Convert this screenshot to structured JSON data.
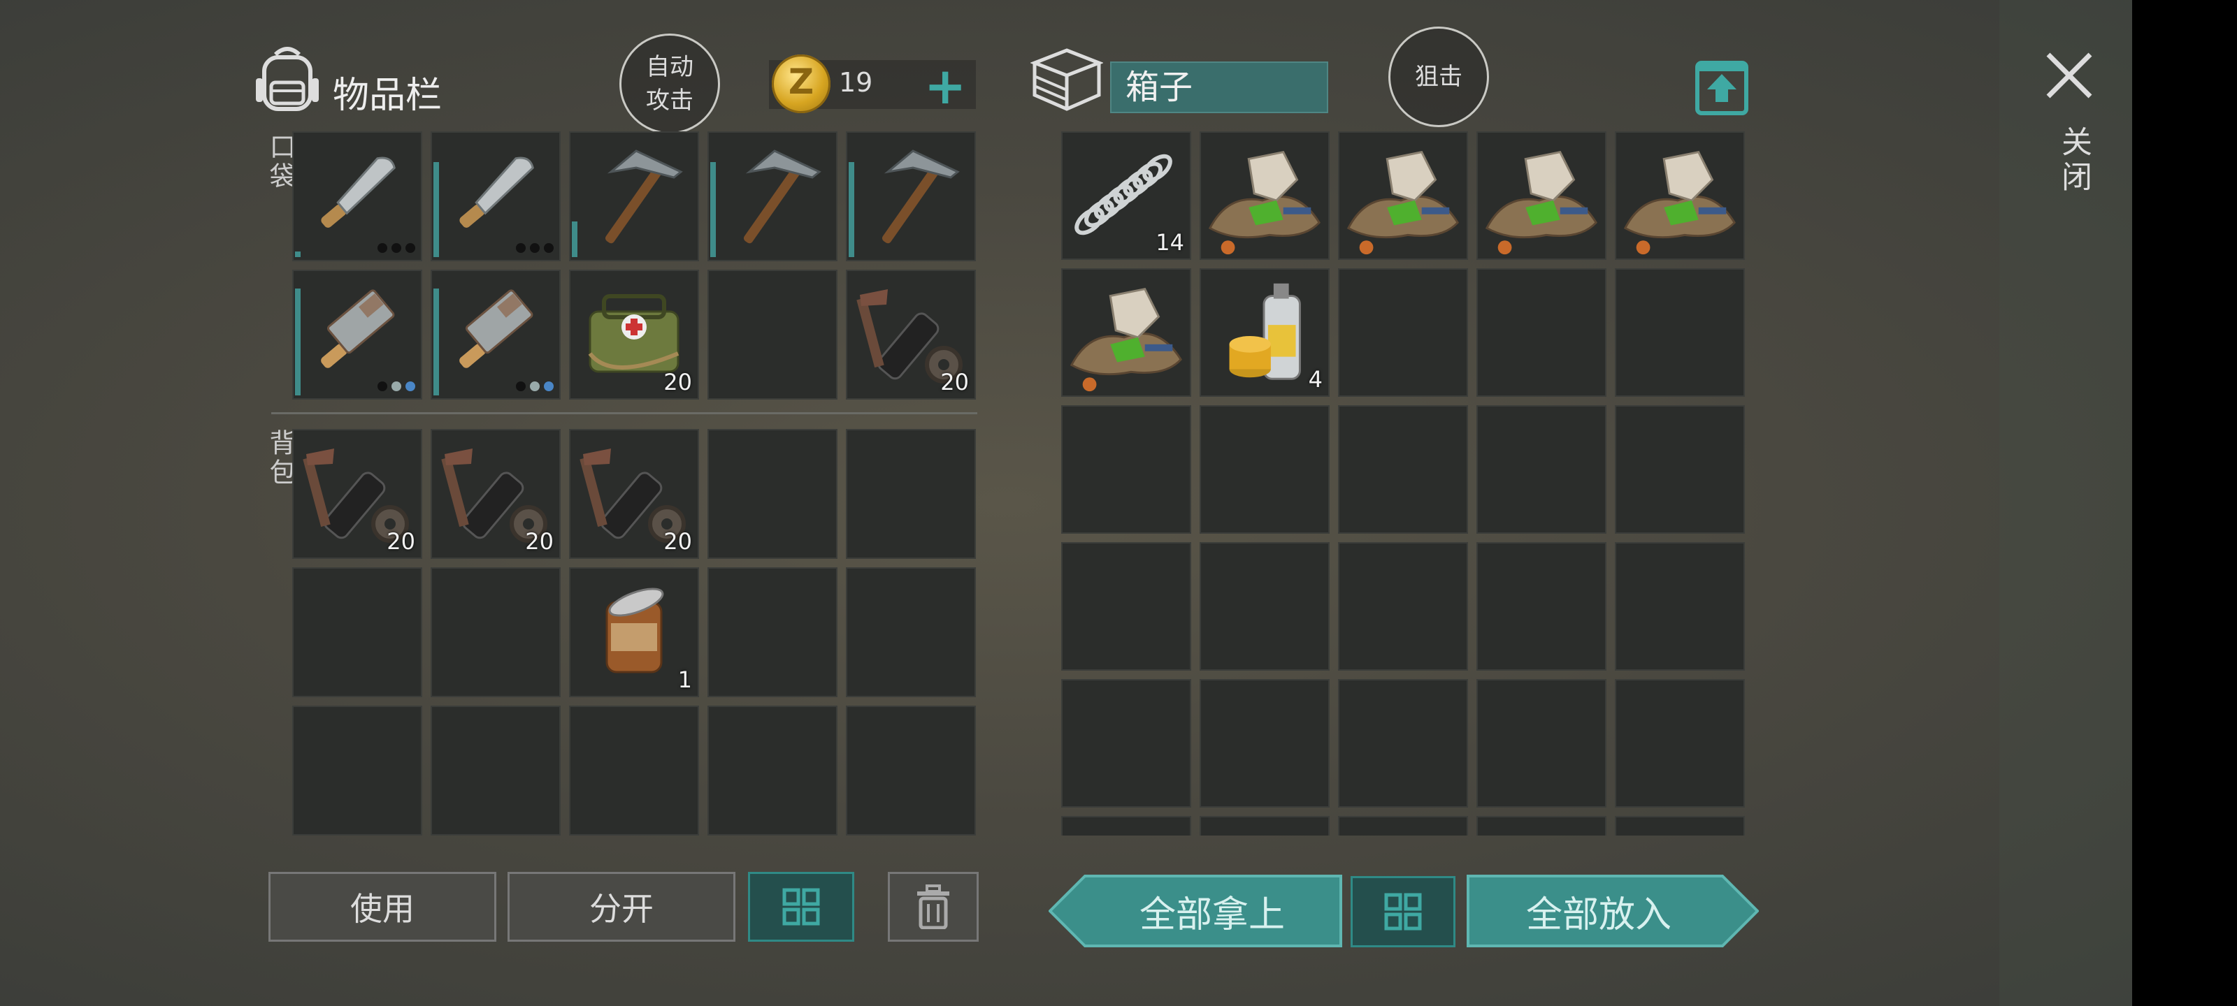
{
  "header": {
    "inventory_title": "物品栏",
    "auto_attack": [
      "自动",
      "攻击"
    ],
    "coin_count": "19",
    "plus": "+",
    "box_title": "箱子",
    "snipe": "狙击",
    "close": "关闭"
  },
  "sections": {
    "pockets": "口袋",
    "backpack": "背包"
  },
  "pockets": [
    {
      "icon": "machete-icon",
      "count": "",
      "bar": 0.05,
      "dots": [
        "d",
        "d",
        "d"
      ]
    },
    {
      "icon": "machete-icon",
      "count": "",
      "bar": 0.8,
      "dots": [
        "d",
        "d",
        "d"
      ]
    },
    {
      "icon": "hammer-icon",
      "count": "",
      "bar": 0.3,
      "dots": []
    },
    {
      "icon": "hammer-icon",
      "count": "",
      "bar": 0.8,
      "dots": []
    },
    {
      "icon": "hammer-icon",
      "count": "",
      "bar": 0.8,
      "dots": []
    },
    {
      "icon": "cleaver-icon",
      "count": "",
      "bar": 0.9,
      "dots": [
        "d",
        "w",
        "b"
      ]
    },
    {
      "icon": "cleaver-icon",
      "count": "",
      "bar": 0.9,
      "dots": [
        "d",
        "w",
        "b"
      ]
    },
    {
      "icon": "medkit-icon",
      "count": "20",
      "bar": 0,
      "dots": []
    },
    {
      "icon": "",
      "count": "",
      "bar": 0,
      "dots": []
    },
    {
      "icon": "toolkit-icon",
      "count": "20",
      "bar": 0,
      "dots": []
    }
  ],
  "backpack": [
    {
      "icon": "toolkit-icon",
      "count": "20"
    },
    {
      "icon": "toolkit-icon",
      "count": "20"
    },
    {
      "icon": "toolkit-icon",
      "count": "20"
    },
    {
      "icon": "",
      "count": ""
    },
    {
      "icon": "",
      "count": ""
    },
    {
      "icon": "",
      "count": ""
    },
    {
      "icon": "",
      "count": ""
    },
    {
      "icon": "can-icon",
      "count": "1"
    },
    {
      "icon": "",
      "count": ""
    },
    {
      "icon": "",
      "count": ""
    },
    {
      "icon": "",
      "count": ""
    },
    {
      "icon": "",
      "count": ""
    },
    {
      "icon": "",
      "count": ""
    },
    {
      "icon": "",
      "count": ""
    },
    {
      "icon": "",
      "count": ""
    }
  ],
  "box": [
    {
      "icon": "spring-icon",
      "count": "14"
    },
    {
      "icon": "scrap-pile-icon",
      "count": ""
    },
    {
      "icon": "scrap-pile-icon",
      "count": ""
    },
    {
      "icon": "scrap-pile-icon",
      "count": ""
    },
    {
      "icon": "scrap-pile-icon",
      "count": ""
    },
    {
      "icon": "scrap-pile-icon",
      "count": ""
    },
    {
      "icon": "spray-paint-icon",
      "count": "4"
    },
    {
      "icon": "",
      "count": ""
    },
    {
      "icon": "",
      "count": ""
    },
    {
      "icon": "",
      "count": ""
    },
    {
      "icon": "",
      "count": ""
    },
    {
      "icon": "",
      "count": ""
    },
    {
      "icon": "",
      "count": ""
    },
    {
      "icon": "",
      "count": ""
    },
    {
      "icon": "",
      "count": ""
    },
    {
      "icon": "",
      "count": ""
    },
    {
      "icon": "",
      "count": ""
    },
    {
      "icon": "",
      "count": ""
    },
    {
      "icon": "",
      "count": ""
    },
    {
      "icon": "",
      "count": ""
    },
    {
      "icon": "",
      "count": ""
    },
    {
      "icon": "",
      "count": ""
    },
    {
      "icon": "",
      "count": ""
    },
    {
      "icon": "",
      "count": ""
    },
    {
      "icon": "",
      "count": ""
    },
    {
      "icon": "",
      "count": ""
    },
    {
      "icon": "",
      "count": ""
    },
    {
      "icon": "",
      "count": ""
    },
    {
      "icon": "",
      "count": ""
    },
    {
      "icon": "",
      "count": ""
    }
  ],
  "actions": {
    "use": "使用",
    "split": "分开",
    "take_all": "全部拿上",
    "put_all": "全部放入"
  },
  "colors": {
    "accent": "#3fa9a3",
    "durability": "#3f8c8a",
    "box_input": "#3a6e6c"
  }
}
